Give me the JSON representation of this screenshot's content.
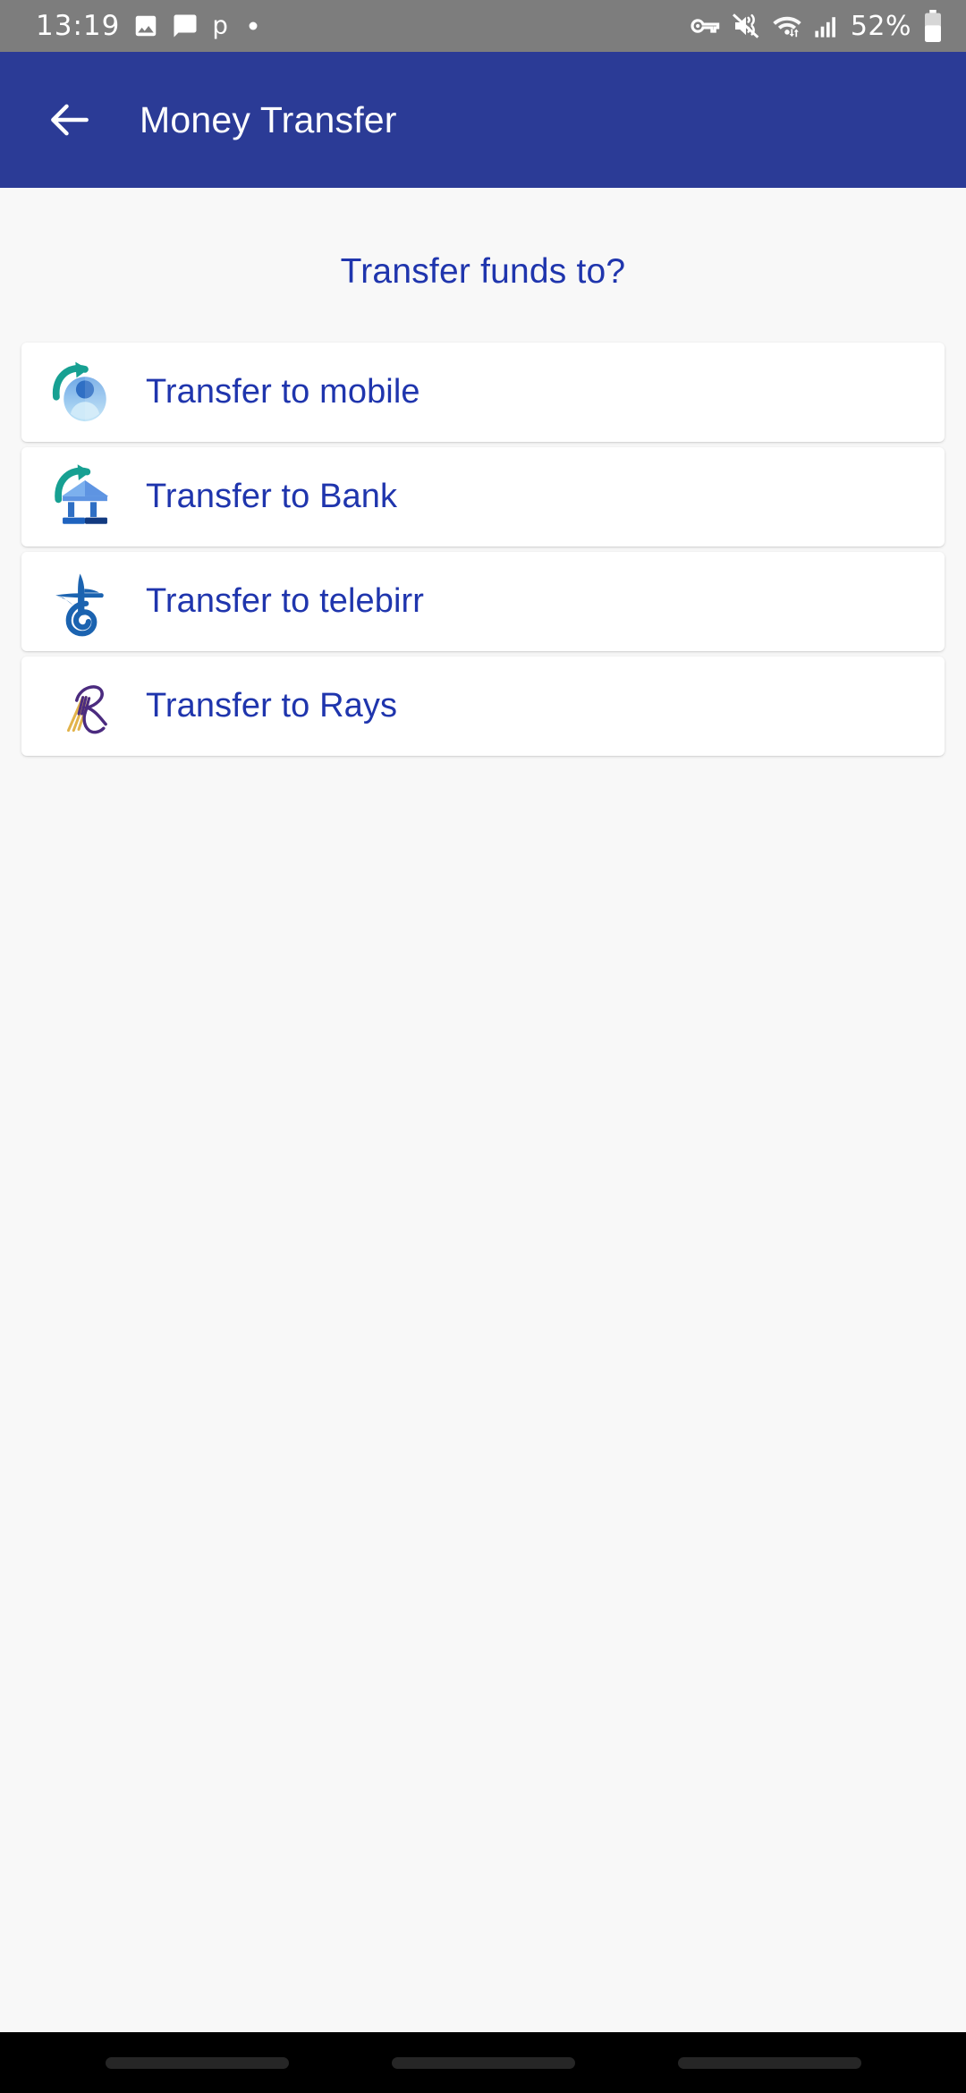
{
  "status_bar": {
    "time": "13:19",
    "battery_percent": "52%",
    "left_icons": [
      "photo-icon",
      "message-icon",
      "letter-p-icon",
      "dot-icon"
    ],
    "right_icons": [
      "vpn-key-icon",
      "vibrate-mute-icon",
      "wifi-icon",
      "cellular-signal-icon",
      "battery-icon"
    ],
    "background": "#7d7d7d"
  },
  "app_bar": {
    "back_label": "back-arrow",
    "title": "Money Transfer",
    "background": "#2b3b96",
    "text_color": "#ffffff"
  },
  "main": {
    "heading": "Transfer funds to?",
    "accent_color": "#1f35ad",
    "options": [
      {
        "label": "Transfer to mobile",
        "icon": "transfer-to-mobile-icon"
      },
      {
        "label": "Transfer to Bank",
        "icon": "transfer-to-bank-icon"
      },
      {
        "label": "Transfer to telebirr",
        "icon": "telebirr-logo-icon"
      },
      {
        "label": "Transfer to Rays",
        "icon": "rays-logo-icon"
      }
    ]
  },
  "nav_bar": {
    "background": "#000000",
    "hints": [
      "recents-pill",
      "home-pill",
      "back-pill"
    ]
  }
}
